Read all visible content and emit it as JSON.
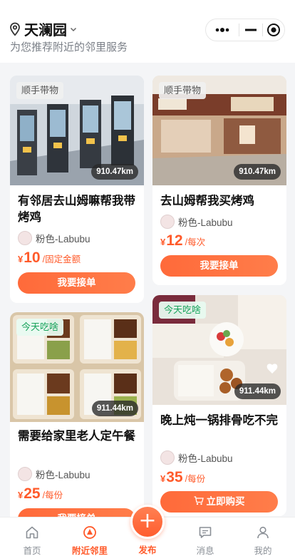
{
  "header": {
    "location": "天澜园",
    "subtitle": "为您推荐附近的邻里服务"
  },
  "cards": [
    {
      "tag": "顺手带物",
      "distance": "910.47km",
      "title": "有邻居去山姆嘛帮我带烤鸡",
      "user": "粉色-Labubu",
      "currency": "¥",
      "price": "10",
      "unit": "/固定金额",
      "button": "我要接单"
    },
    {
      "tag": "顺手带物",
      "distance": "910.47km",
      "title": "去山姆帮我买烤鸡",
      "user": "粉色-Labubu",
      "currency": "¥",
      "price": "12",
      "unit": "/每次",
      "button": "我要接单"
    },
    {
      "tag": "今天吃啥",
      "distance": "911.44km",
      "title": "需要给家里老人定午餐",
      "user": "粉色-Labubu",
      "currency": "¥",
      "price": "25",
      "unit": "/每份",
      "button": "我要接单"
    },
    {
      "tag": "今天吃啥",
      "distance": "911.44km",
      "title": "晚上炖一锅排骨吃不完",
      "user": "粉色-Labubu",
      "currency": "¥",
      "price": "35",
      "unit": "/每份",
      "button": "立即购买"
    }
  ],
  "tabbar": {
    "items": [
      {
        "label": "首页",
        "icon": "home-icon"
      },
      {
        "label": "附近邻里",
        "icon": "nearby-icon",
        "active": true
      },
      {
        "label": "发布",
        "icon": "plus-icon"
      },
      {
        "label": "消息",
        "icon": "message-icon"
      },
      {
        "label": "我的",
        "icon": "user-icon"
      }
    ]
  },
  "colors": {
    "accent": "#ff5a2a",
    "tag_green": "#19a35c"
  }
}
